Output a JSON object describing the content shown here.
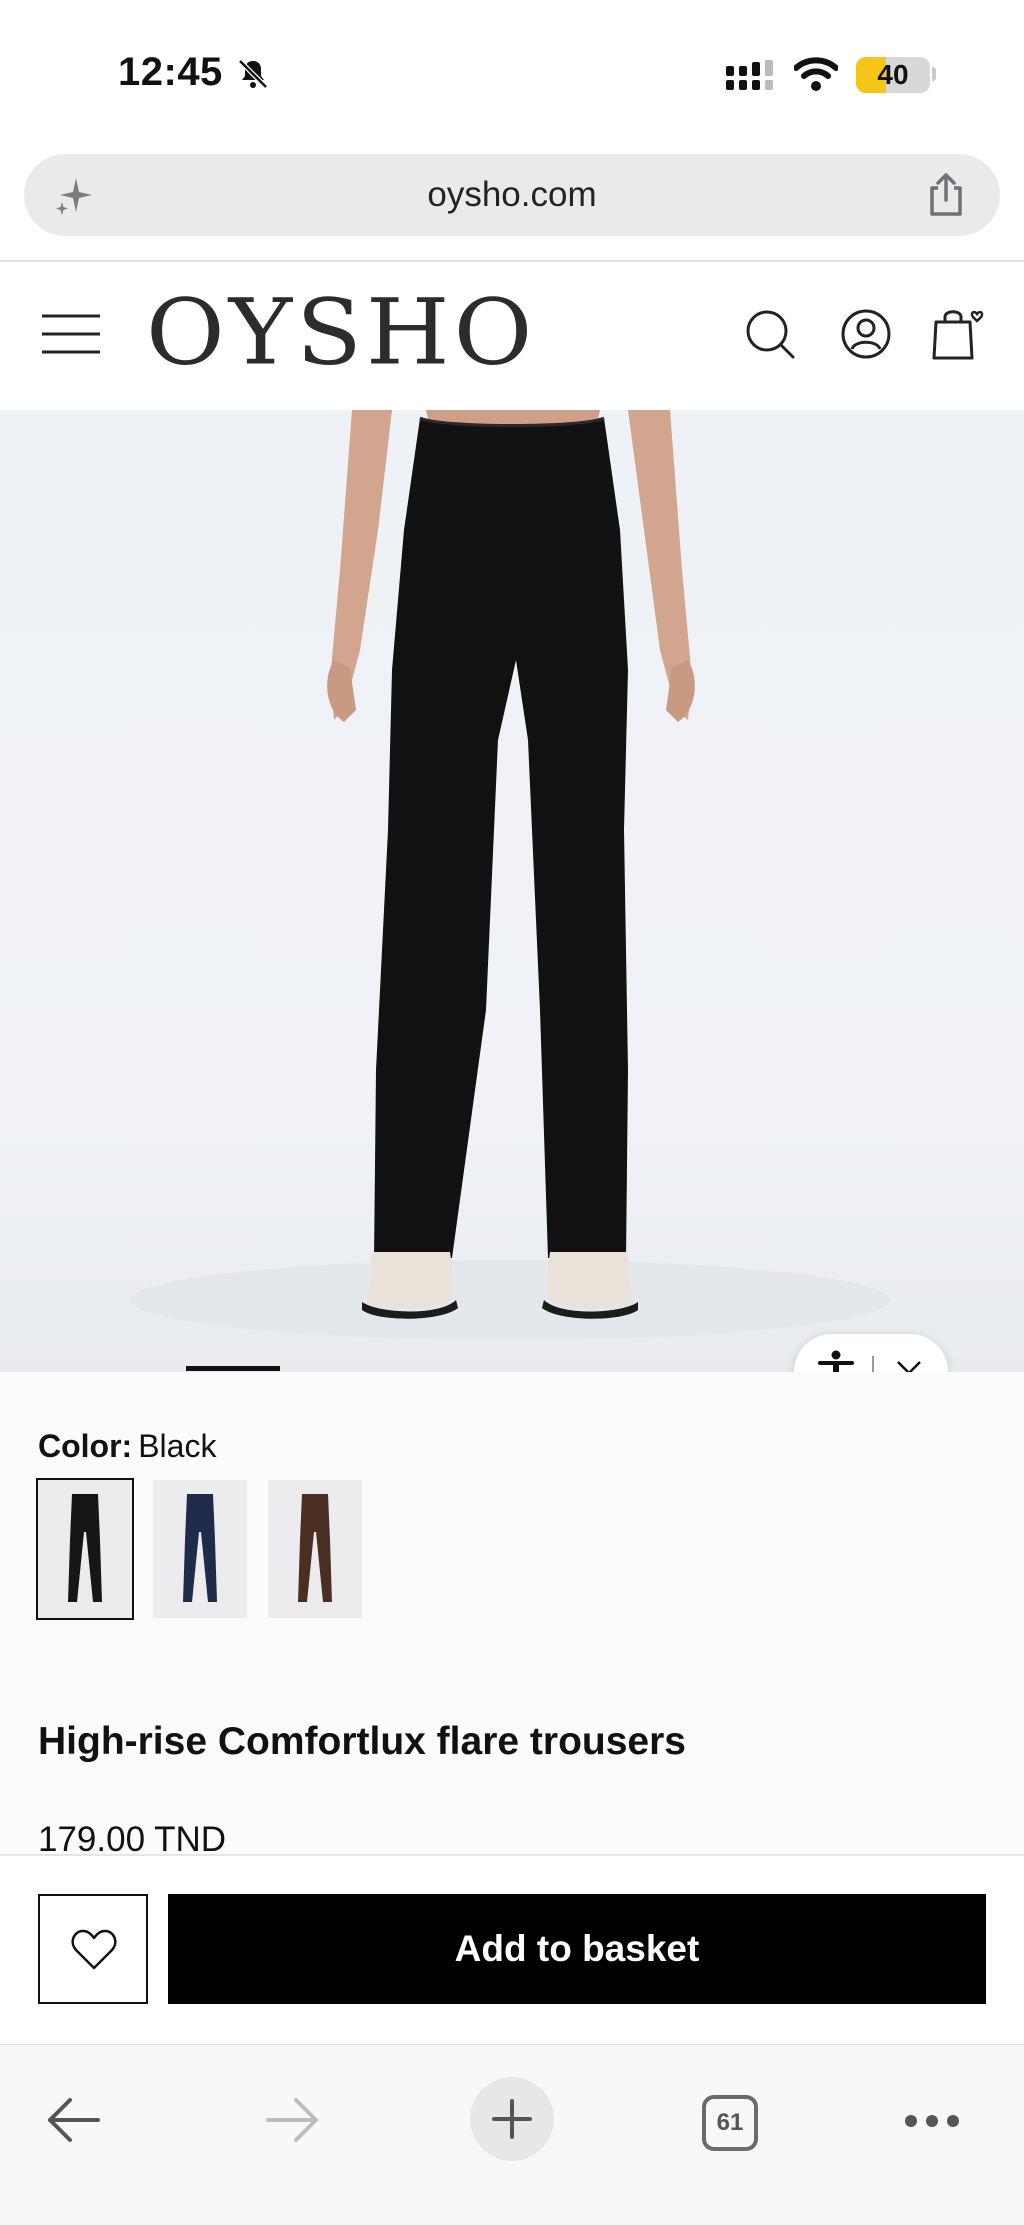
{
  "status_bar": {
    "time": "12:45",
    "battery_level": "40",
    "battery_fraction": 0.4,
    "battery_color": "#f5c518"
  },
  "browser": {
    "url": "oysho.com",
    "tab_count": "61"
  },
  "site_header": {
    "brand": "OYSHO",
    "icons": [
      "menu-icon",
      "search-icon",
      "account-icon",
      "bag-icon"
    ]
  },
  "product": {
    "color_label": "Color:",
    "color_value": "Black",
    "swatches": [
      {
        "name": "Black",
        "hex": "#161616",
        "selected": true
      },
      {
        "name": "Navy",
        "hex": "#1f2c49",
        "selected": false
      },
      {
        "name": "Brown",
        "hex": "#4a2e22",
        "selected": false
      }
    ],
    "title": "High-rise Comfortlux flare trousers",
    "price": "179.00 TND"
  },
  "actions": {
    "add_to_basket": "Add to basket",
    "primary_color": "#000000"
  }
}
